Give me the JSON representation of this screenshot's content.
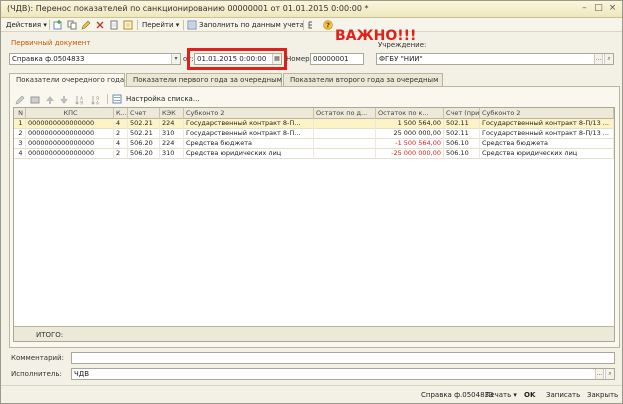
{
  "window": {
    "title": "(ЧДВ): Перенос показателей по санкционированию 00000001 от 01.01.2015 0:00:00 *"
  },
  "toolbar": {
    "actions_label": "Действия",
    "goto_label": "Перейти",
    "fill_label": "Заполнить по данным учета"
  },
  "header": {
    "primary_doc_label": "Первичный документ",
    "primary_doc_value": "Справка ф.0504833",
    "from_label": "от:",
    "date_value": "01.01.2015  0:00:00",
    "number_label": "Номер:",
    "number_value": "00000001",
    "institution_label": "Учреждение:",
    "institution_value": "ФГБУ \"НИИ\""
  },
  "annotation": {
    "important": "ВАЖНО!!!"
  },
  "tabs": [
    {
      "label": "Показатели очередного года"
    },
    {
      "label": "Показатели первого года за очередным"
    },
    {
      "label": "Показатели второго года за очередным"
    }
  ],
  "grid_toolbar": {
    "settings_label": "Настройка списка..."
  },
  "table": {
    "columns": [
      "N",
      "КПС",
      "К...",
      "Счет",
      "КЭК",
      "Субконто 2",
      "Остаток по д...",
      "Остаток по к...",
      "Счет (при...",
      "Субконто 2"
    ],
    "rows": [
      {
        "n": "1",
        "kps": "0000000000000000",
        "k": "4",
        "account": "502.21",
        "kek": "224",
        "sub": "Государственный контракт 8-П...",
        "debit": "",
        "credit": "1 500 564,00",
        "account2": "502.11",
        "sub2": "Государственный контракт 8-П/13 ..."
      },
      {
        "n": "2",
        "kps": "0000000000000000",
        "k": "2",
        "account": "502.21",
        "kek": "310",
        "sub": "Государственный контракт 8-П...",
        "debit": "",
        "credit": "25 000 000,00",
        "account2": "502.11",
        "sub2": "Государственный контракт 8-П/13 ..."
      },
      {
        "n": "3",
        "kps": "0000000000000000",
        "k": "4",
        "account": "506.20",
        "kek": "224",
        "sub": "Средства бюджета",
        "debit": "",
        "credit": "-1 500 564,00",
        "account2": "506.10",
        "sub2": "Средства бюджета"
      },
      {
        "n": "4",
        "kps": "0000000000000000",
        "k": "2",
        "account": "506.20",
        "kek": "310",
        "sub": "Средства юридических лиц",
        "debit": "",
        "credit": "-25 000 000,00",
        "account2": "506.10",
        "sub2": "Средства юридических лиц"
      }
    ],
    "total_label": "ИТОГО:"
  },
  "footer_fields": {
    "comment_label": "Комментарий:",
    "comment_value": "",
    "executor_label": "Исполнитель:",
    "executor_value": "ЧДВ"
  },
  "bottom_bar": {
    "print_form": "Справка ф.0504833",
    "print_label": "Печать",
    "ok_label": "OK",
    "save_label": "Записать",
    "close_label": "Закрыть"
  },
  "colors": {
    "accent_orange": "#c25a00",
    "highlight_red": "#e0201a"
  }
}
